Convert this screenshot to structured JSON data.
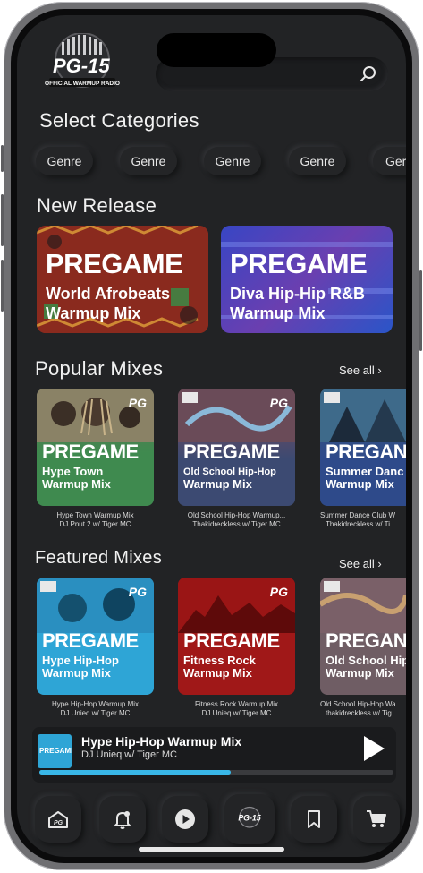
{
  "app": {
    "logo_text": "PG-15",
    "logo_tagline": "OFFICIAL WARMUP RADIO"
  },
  "search": {
    "icon": "search-icon"
  },
  "categories": {
    "title": "Select Categories",
    "chips": [
      "Genre",
      "Genre",
      "Genre",
      "Genre",
      "Ger"
    ]
  },
  "new_release": {
    "title": "New Release",
    "items": [
      {
        "brand": "PREGAME",
        "line1": "World Afrobeats",
        "line2": "Warmup Mix",
        "color": "#8a2a1e"
      },
      {
        "brand": "PREGAME",
        "line1": "Diva Hip-Hip R&B",
        "line2": "Warmup Mix",
        "color": "#3a46b4"
      }
    ]
  },
  "popular": {
    "title": "Popular Mixes",
    "see_all": "See all",
    "items": [
      {
        "brand": "PREGAME",
        "line1": "Hype Town",
        "line2": "Warmup Mix",
        "cap1": "Hype Town Warmup Mix",
        "cap2": "DJ Pnut 2 w/ Tiger MC",
        "color": "#3f8a4f"
      },
      {
        "brand": "PREGAME",
        "line1": "Old School Hip-Hop",
        "line2": "Warmup Mix",
        "cap1": "Old School Hip-Hop Warmup...",
        "cap2": "Thakidreckless w/ Tiger MC",
        "color": "#3c4a72"
      },
      {
        "brand": "PREGAN",
        "line1": "Summer Danc",
        "line2": "Warmup Mix",
        "cap1": "Summer Dance Club W",
        "cap2": "Thakidreckless w/ Ti",
        "color": "#2e4a8a"
      }
    ]
  },
  "featured": {
    "title": "Featured Mixes",
    "see_all": "See all",
    "items": [
      {
        "brand": "PREGAME",
        "line1": "Hype Hip-Hop",
        "line2": "Warmup Mix",
        "cap1": "Hype Hip-Hop Warmup Mix",
        "cap2": "DJ Unieq w/ Tiger MC",
        "color": "#2ea5d6"
      },
      {
        "brand": "PREGAME",
        "line1": "Fitness Rock",
        "line2": "Warmup Mix",
        "cap1": "Fitness Rock Warmup Mix",
        "cap2": "DJ Unieq w/ Tiger MC",
        "color": "#a01818"
      },
      {
        "brand": "PREGAN",
        "line1": "Old School Hip",
        "line2": "Warmup Mix",
        "cap1": "Old School Hip-Hop Wa",
        "cap2": "thakidreckless w/ Tig",
        "color": "#6f5d64"
      }
    ]
  },
  "now_playing": {
    "title": "Hype Hip-Hop Warmup Mix",
    "artist": "DJ Unieq w/ Tiger MC",
    "art_brand": "PREGAME",
    "progress": 0.54,
    "accent": "#39b7e8"
  },
  "nav": {
    "items": [
      "home-icon",
      "notification-bell-icon",
      "play-icon",
      "pg15-logo-icon",
      "bookmark-icon",
      "cart-icon"
    ]
  }
}
